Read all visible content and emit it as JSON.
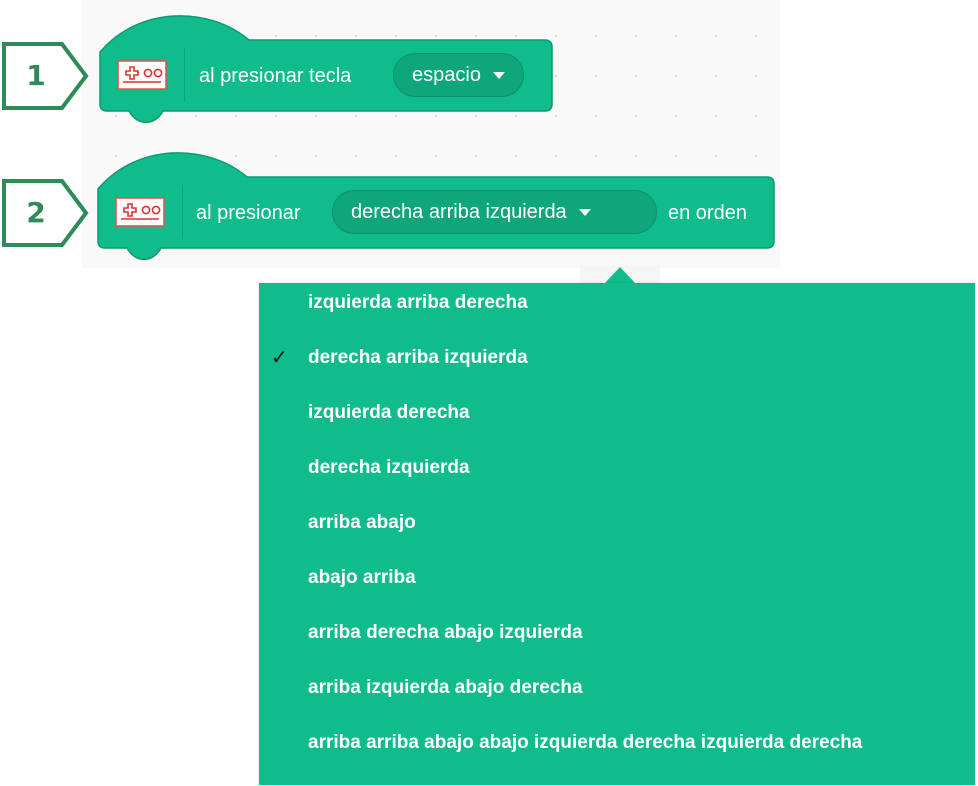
{
  "colors": {
    "block": "#10bc8c",
    "block_border": "#0b9a71",
    "dropdown_fill": "#0fa67a",
    "callout": "#2e8b57",
    "check": "#1b1b1b"
  },
  "callouts": [
    "1",
    "2"
  ],
  "blocks": [
    {
      "icon": "controller-extension-icon",
      "label": "al presionar tecla",
      "dropdown_value": "espacio"
    },
    {
      "icon": "controller-extension-icon",
      "label": "al presionar",
      "dropdown_value": "derecha arriba izquierda",
      "suffix": "en orden"
    }
  ],
  "menu": {
    "selected_index": 1,
    "check_mark": "✓",
    "items": [
      "izquierda arriba derecha",
      "derecha arriba izquierda",
      "izquierda derecha",
      "derecha izquierda",
      "arriba abajo",
      "abajo arriba",
      "arriba derecha abajo izquierda",
      "arriba izquierda abajo derecha",
      "arriba arriba abajo abajo izquierda derecha izquierda derecha"
    ]
  }
}
